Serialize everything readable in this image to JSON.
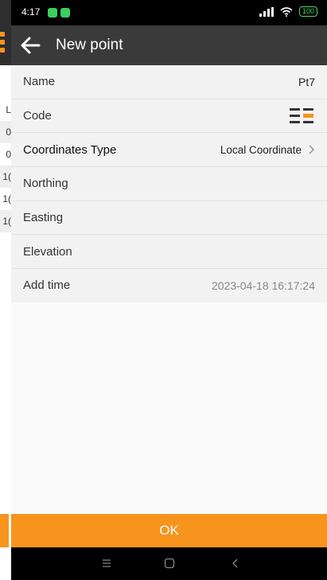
{
  "status_bar": {
    "time": "4:17",
    "battery": "100"
  },
  "app_bar": {
    "title": "New point"
  },
  "form": {
    "rows": [
      {
        "label": "Name",
        "value": "Pt7"
      },
      {
        "label": "Code",
        "value": ""
      },
      {
        "label": "Coordinates Type",
        "value": "Local Coordinate"
      },
      {
        "label": "Northing",
        "value": ""
      },
      {
        "label": "Easting",
        "value": ""
      },
      {
        "label": "Elevation",
        "value": ""
      },
      {
        "label": "Add time",
        "value": "2023-04-18 16:17:24"
      }
    ]
  },
  "background_list": {
    "rows": [
      "L",
      "0",
      "0",
      "1(",
      "1(",
      "1("
    ]
  },
  "actions": {
    "ok_label": "OK"
  },
  "colors": {
    "accent": "#f7941d",
    "appbar": "#3a3a3a",
    "statusbar": "#000000"
  }
}
